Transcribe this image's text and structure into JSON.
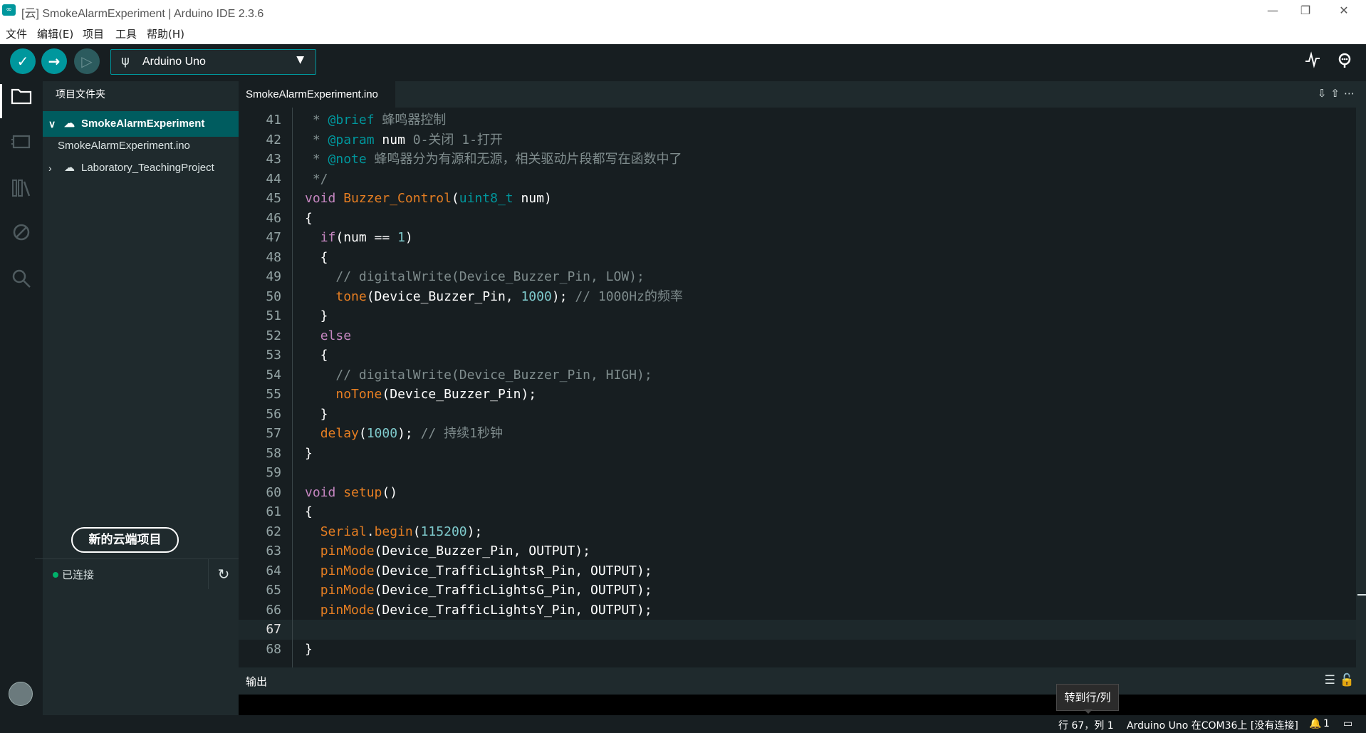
{
  "window": {
    "title": "[云] SmokeAlarmExperiment | Arduino IDE 2.3.6",
    "controls": {
      "minimize": "—",
      "restore": "❐",
      "close": "✕"
    }
  },
  "menu": [
    "文件",
    "编辑(E)",
    "项目",
    "工具",
    "帮助(H)"
  ],
  "toolbar": {
    "verify_icon": "check-icon",
    "upload_icon": "arrow-right-icon",
    "debug_icon": "debug-icon",
    "board": "Arduino Uno",
    "serial_plotter_icon": "plotter-icon",
    "serial_monitor_icon": "monitor-icon"
  },
  "sidebar": {
    "title": "项目文件夹",
    "tabs": [
      "local-sketch-icon",
      "cloud-icon"
    ],
    "tree": [
      {
        "label": "SmokeAlarmExperiment",
        "expanded": true,
        "cloud": true
      },
      {
        "label": "SmokeAlarmExperiment.ino",
        "file": true
      },
      {
        "label": "Laboratory_TeachingProject",
        "expanded": false,
        "cloud": true
      }
    ],
    "new_cloud_button": "新的云端项目",
    "connection_status": "已连接"
  },
  "editor": {
    "tab": "SmokeAlarmExperiment.ino",
    "current_line": 67,
    "lines": [
      {
        "n": 41,
        "code": " * @brief 蜂鸣器控制"
      },
      {
        "n": 42,
        "code": " * @param num 0-关闭 1-打开"
      },
      {
        "n": 43,
        "code": " * @note 蜂鸣器分为有源和无源，相关驱动片段都写在函数中了"
      },
      {
        "n": 44,
        "code": " */"
      },
      {
        "n": 45,
        "code": "void Buzzer_Control(uint8_t num)"
      },
      {
        "n": 46,
        "code": "{"
      },
      {
        "n": 47,
        "code": "  if(num == 1)"
      },
      {
        "n": 48,
        "code": "  {"
      },
      {
        "n": 49,
        "code": "    // digitalWrite(Device_Buzzer_Pin, LOW);"
      },
      {
        "n": 50,
        "code": "    tone(Device_Buzzer_Pin, 1000); // 1000Hz的频率"
      },
      {
        "n": 51,
        "code": "  }"
      },
      {
        "n": 52,
        "code": "  else"
      },
      {
        "n": 53,
        "code": "  {"
      },
      {
        "n": 54,
        "code": "    // digitalWrite(Device_Buzzer_Pin, HIGH);"
      },
      {
        "n": 55,
        "code": "    noTone(Device_Buzzer_Pin);"
      },
      {
        "n": 56,
        "code": "  }"
      },
      {
        "n": 57,
        "code": "  delay(1000); // 持续1秒钟"
      },
      {
        "n": 58,
        "code": "}"
      },
      {
        "n": 59,
        "code": ""
      },
      {
        "n": 60,
        "code": "void setup()"
      },
      {
        "n": 61,
        "code": "{"
      },
      {
        "n": 62,
        "code": "  Serial.begin(115200);"
      },
      {
        "n": 63,
        "code": "  pinMode(Device_Buzzer_Pin, OUTPUT);"
      },
      {
        "n": 64,
        "code": "  pinMode(Device_TrafficLightsR_Pin, OUTPUT);"
      },
      {
        "n": 65,
        "code": "  pinMode(Device_TrafficLightsG_Pin, OUTPUT);"
      },
      {
        "n": 66,
        "code": "  pinMode(Device_TrafficLightsY_Pin, OUTPUT);"
      },
      {
        "n": 67,
        "code": ""
      },
      {
        "n": 68,
        "code": "}"
      }
    ]
  },
  "output": {
    "title": "输出"
  },
  "tooltip": "转到行/列",
  "status": {
    "position": "行 67，列 1",
    "board_port": "Arduino Uno 在COM36上 [没有连接]",
    "notifications": "1"
  },
  "colors": {
    "accent": "#00979d",
    "keyword": "#c586c0",
    "function": "#e67e22",
    "number": "#7fcbcd",
    "comment": "#7f8c8d"
  }
}
